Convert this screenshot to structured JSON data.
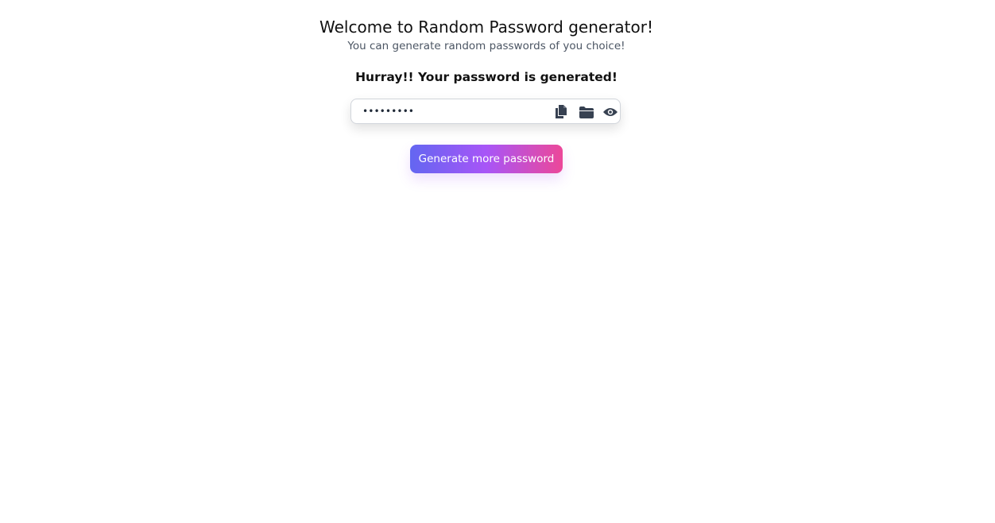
{
  "header": {
    "title": "Welcome to Random Password generator!",
    "subtitle": "You can generate random passwords of you choice!"
  },
  "result": {
    "message": "Hurray!! Your password is generated!",
    "password_masked": "•••••••••"
  },
  "icons": {
    "copy": "copy-icon",
    "folder": "folder-icon",
    "visibility": "eye-icon",
    "color": "#374151"
  },
  "actions": {
    "generate_label": "Generate more password"
  },
  "colors": {
    "gradient_start": "#6366f1",
    "gradient_mid": "#a855f7",
    "gradient_end": "#ec4899"
  }
}
